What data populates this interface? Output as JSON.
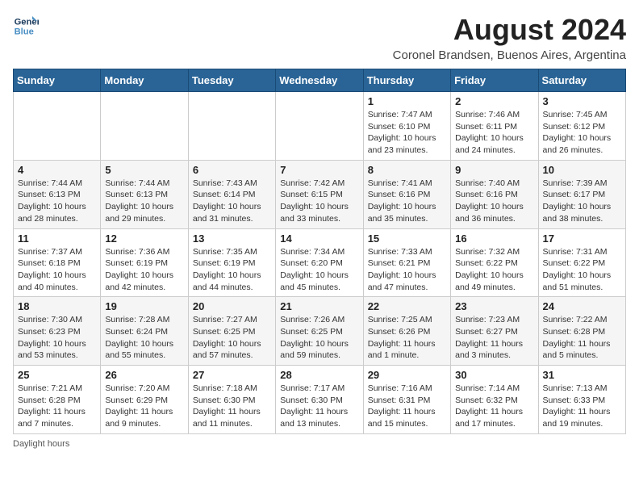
{
  "header": {
    "logo_line1": "General",
    "logo_line2": "Blue",
    "month_year": "August 2024",
    "location": "Coronel Brandsen, Buenos Aires, Argentina"
  },
  "days_of_week": [
    "Sunday",
    "Monday",
    "Tuesday",
    "Wednesday",
    "Thursday",
    "Friday",
    "Saturday"
  ],
  "weeks": [
    [
      {
        "day": "",
        "info": ""
      },
      {
        "day": "",
        "info": ""
      },
      {
        "day": "",
        "info": ""
      },
      {
        "day": "",
        "info": ""
      },
      {
        "day": "1",
        "info": "Sunrise: 7:47 AM\nSunset: 6:10 PM\nDaylight: 10 hours\nand 23 minutes."
      },
      {
        "day": "2",
        "info": "Sunrise: 7:46 AM\nSunset: 6:11 PM\nDaylight: 10 hours\nand 24 minutes."
      },
      {
        "day": "3",
        "info": "Sunrise: 7:45 AM\nSunset: 6:12 PM\nDaylight: 10 hours\nand 26 minutes."
      }
    ],
    [
      {
        "day": "4",
        "info": "Sunrise: 7:44 AM\nSunset: 6:13 PM\nDaylight: 10 hours\nand 28 minutes."
      },
      {
        "day": "5",
        "info": "Sunrise: 7:44 AM\nSunset: 6:13 PM\nDaylight: 10 hours\nand 29 minutes."
      },
      {
        "day": "6",
        "info": "Sunrise: 7:43 AM\nSunset: 6:14 PM\nDaylight: 10 hours\nand 31 minutes."
      },
      {
        "day": "7",
        "info": "Sunrise: 7:42 AM\nSunset: 6:15 PM\nDaylight: 10 hours\nand 33 minutes."
      },
      {
        "day": "8",
        "info": "Sunrise: 7:41 AM\nSunset: 6:16 PM\nDaylight: 10 hours\nand 35 minutes."
      },
      {
        "day": "9",
        "info": "Sunrise: 7:40 AM\nSunset: 6:16 PM\nDaylight: 10 hours\nand 36 minutes."
      },
      {
        "day": "10",
        "info": "Sunrise: 7:39 AM\nSunset: 6:17 PM\nDaylight: 10 hours\nand 38 minutes."
      }
    ],
    [
      {
        "day": "11",
        "info": "Sunrise: 7:37 AM\nSunset: 6:18 PM\nDaylight: 10 hours\nand 40 minutes."
      },
      {
        "day": "12",
        "info": "Sunrise: 7:36 AM\nSunset: 6:19 PM\nDaylight: 10 hours\nand 42 minutes."
      },
      {
        "day": "13",
        "info": "Sunrise: 7:35 AM\nSunset: 6:19 PM\nDaylight: 10 hours\nand 44 minutes."
      },
      {
        "day": "14",
        "info": "Sunrise: 7:34 AM\nSunset: 6:20 PM\nDaylight: 10 hours\nand 45 minutes."
      },
      {
        "day": "15",
        "info": "Sunrise: 7:33 AM\nSunset: 6:21 PM\nDaylight: 10 hours\nand 47 minutes."
      },
      {
        "day": "16",
        "info": "Sunrise: 7:32 AM\nSunset: 6:22 PM\nDaylight: 10 hours\nand 49 minutes."
      },
      {
        "day": "17",
        "info": "Sunrise: 7:31 AM\nSunset: 6:22 PM\nDaylight: 10 hours\nand 51 minutes."
      }
    ],
    [
      {
        "day": "18",
        "info": "Sunrise: 7:30 AM\nSunset: 6:23 PM\nDaylight: 10 hours\nand 53 minutes."
      },
      {
        "day": "19",
        "info": "Sunrise: 7:28 AM\nSunset: 6:24 PM\nDaylight: 10 hours\nand 55 minutes."
      },
      {
        "day": "20",
        "info": "Sunrise: 7:27 AM\nSunset: 6:25 PM\nDaylight: 10 hours\nand 57 minutes."
      },
      {
        "day": "21",
        "info": "Sunrise: 7:26 AM\nSunset: 6:25 PM\nDaylight: 10 hours\nand 59 minutes."
      },
      {
        "day": "22",
        "info": "Sunrise: 7:25 AM\nSunset: 6:26 PM\nDaylight: 11 hours\nand 1 minute."
      },
      {
        "day": "23",
        "info": "Sunrise: 7:23 AM\nSunset: 6:27 PM\nDaylight: 11 hours\nand 3 minutes."
      },
      {
        "day": "24",
        "info": "Sunrise: 7:22 AM\nSunset: 6:28 PM\nDaylight: 11 hours\nand 5 minutes."
      }
    ],
    [
      {
        "day": "25",
        "info": "Sunrise: 7:21 AM\nSunset: 6:28 PM\nDaylight: 11 hours\nand 7 minutes."
      },
      {
        "day": "26",
        "info": "Sunrise: 7:20 AM\nSunset: 6:29 PM\nDaylight: 11 hours\nand 9 minutes."
      },
      {
        "day": "27",
        "info": "Sunrise: 7:18 AM\nSunset: 6:30 PM\nDaylight: 11 hours\nand 11 minutes."
      },
      {
        "day": "28",
        "info": "Sunrise: 7:17 AM\nSunset: 6:30 PM\nDaylight: 11 hours\nand 13 minutes."
      },
      {
        "day": "29",
        "info": "Sunrise: 7:16 AM\nSunset: 6:31 PM\nDaylight: 11 hours\nand 15 minutes."
      },
      {
        "day": "30",
        "info": "Sunrise: 7:14 AM\nSunset: 6:32 PM\nDaylight: 11 hours\nand 17 minutes."
      },
      {
        "day": "31",
        "info": "Sunrise: 7:13 AM\nSunset: 6:33 PM\nDaylight: 11 hours\nand 19 minutes."
      }
    ]
  ],
  "footer": {
    "daylight_hours_label": "Daylight hours"
  }
}
